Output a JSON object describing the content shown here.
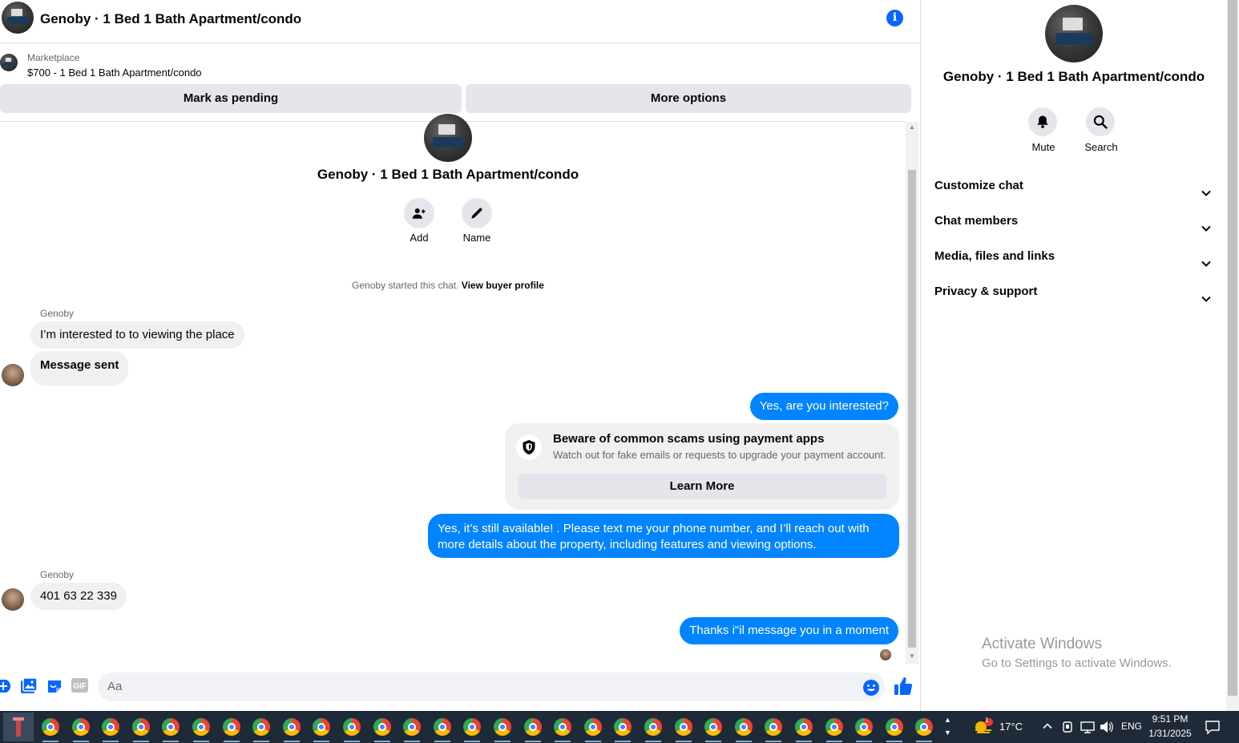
{
  "header": {
    "title": "Genoby · 1 Bed 1 Bath Apartment/condo",
    "info_icon": "info-icon"
  },
  "marketplace": {
    "label": "Marketplace",
    "item": "$700 - 1 Bed 1 Bath Apartment/condo"
  },
  "actions": {
    "pending": "Mark as pending",
    "more": "More options"
  },
  "thread": {
    "title": "Genoby · 1 Bed 1 Bath Apartment/condo",
    "add_label": "Add",
    "name_label": "Name",
    "started_text": "Genoby started this chat.",
    "view_profile": "View buyer profile"
  },
  "messages": {
    "sender1": "Genoby",
    "m1": "I’m interested to to viewing the place",
    "m2": "Message sent",
    "m3": "Yes, are you interested?",
    "scam_title": "Beware of common scams using payment apps",
    "scam_sub": "Watch out for fake emails or requests to upgrade your payment account.",
    "learn_more": "Learn More",
    "m4": "Yes, it’s still available! . Please text me your phone number, and I’ll reach out with more details about the property, including features and viewing options.",
    "sender2": "Genoby",
    "m5": "401 63 22 339",
    "m6": "Thanks i\"il message you in a moment"
  },
  "composer": {
    "placeholder": "Aa"
  },
  "panel": {
    "title": "Genoby · 1 Bed 1 Bath Apartment/condo",
    "mute": "Mute",
    "search": "Search",
    "rows": [
      "Customize chat",
      "Chat members",
      "Media, files and links",
      "Privacy & support"
    ],
    "activate_title": "Activate Windows",
    "activate_sub": "Go to Settings to activate Windows."
  },
  "taskbar": {
    "temperature": "17°C",
    "language": "ENG",
    "time": "9:51 PM",
    "date": "1/31/2025",
    "weather_badge": "1"
  },
  "colors": {
    "accent": "#0084ff",
    "messenger_blue": "#0866ff",
    "bubble_gray": "#f0f0f0"
  }
}
